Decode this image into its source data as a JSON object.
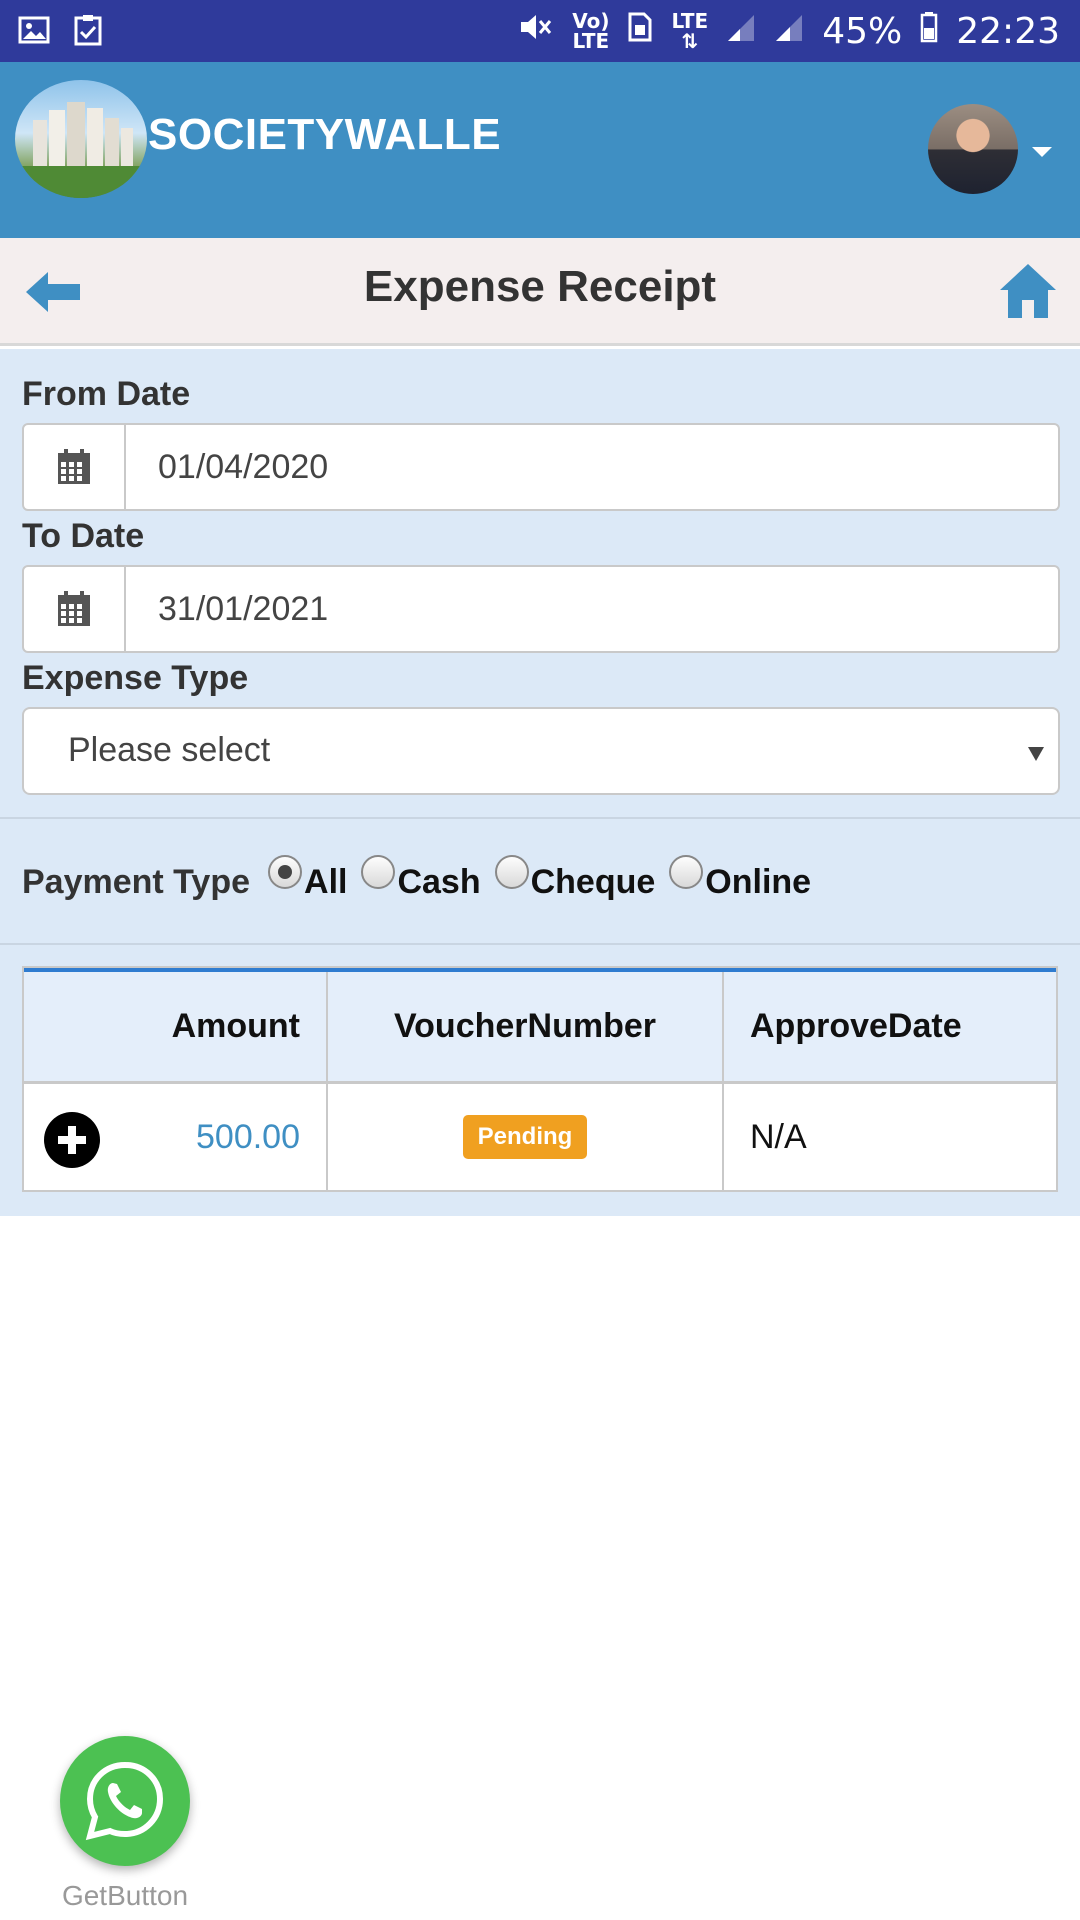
{
  "status_bar": {
    "volte": "Vo)",
    "lte_label": "LTE",
    "lte_main": "LTE",
    "battery": "45%",
    "time": "22:23"
  },
  "app": {
    "brand": "SOCIETYWALLE"
  },
  "page": {
    "title": "Expense Receipt"
  },
  "form": {
    "from_date_label": "From Date",
    "from_date_value": "01/04/2020",
    "to_date_label": "To Date",
    "to_date_value": "31/01/2021",
    "expense_type_label": "Expense Type",
    "expense_type_value": "Please select",
    "payment_type_label": "Payment Type",
    "payment_options": [
      {
        "label": "All",
        "checked": true
      },
      {
        "label": "Cash",
        "checked": false
      },
      {
        "label": "Cheque",
        "checked": false
      },
      {
        "label": "Online",
        "checked": false
      }
    ]
  },
  "table": {
    "headers": [
      "Amount",
      "VoucherNumber",
      "ApproveDate"
    ],
    "rows": [
      {
        "amount": "500.00",
        "voucher": "Pending",
        "approve_date": "N/A"
      }
    ]
  },
  "footer": {
    "get_button_label": "GetButton"
  },
  "colors": {
    "status_bar": "#2f3a9b",
    "header": "#3f8fc3",
    "form_bg": "#dce9f7",
    "badge": "#f0a020",
    "whatsapp": "#4cc152"
  }
}
